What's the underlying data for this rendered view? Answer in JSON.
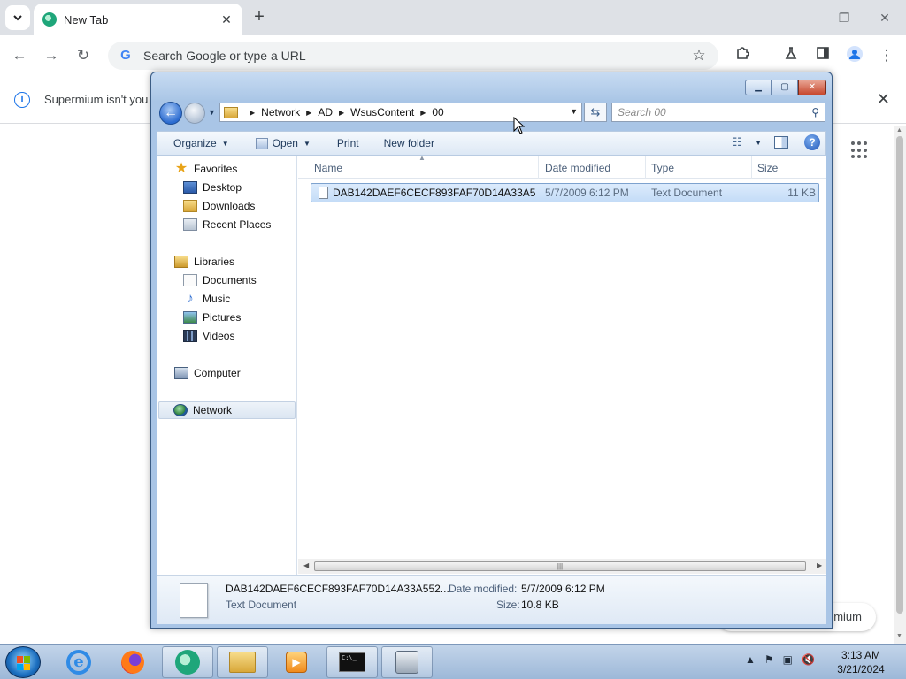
{
  "browser": {
    "tab_title": "New Tab",
    "tab_close_glyph": "✕",
    "new_tab_glyph": "+",
    "omnibox_placeholder": "Search Google or type a URL",
    "omnibox_g": "G",
    "infobar_message": "Supermium isn't you",
    "customize_chip_text": "mium",
    "icons": {
      "tab_search": "chevron-down-icon",
      "back": "back-arrow-icon",
      "forward": "forward-arrow-icon",
      "reload": "reload-icon",
      "bookmark": "star-icon",
      "extensions": "puzzle-icon",
      "labs": "flask-icon",
      "side_panel": "side-panel-icon",
      "profile": "profile-icon",
      "menu": "kebab-menu-icon"
    }
  },
  "explorer": {
    "breadcrumb": [
      "Network",
      "AD",
      "WsusContent",
      "00"
    ],
    "search_placeholder": "Search 00",
    "commands": {
      "organize": "Organize",
      "open": "Open",
      "print": "Print",
      "new_folder": "New folder"
    },
    "nav": {
      "favorites": "Favorites",
      "desktop": "Desktop",
      "downloads": "Downloads",
      "recent": "Recent Places",
      "libraries": "Libraries",
      "documents": "Documents",
      "music": "Music",
      "pictures": "Pictures",
      "videos": "Videos",
      "computer": "Computer",
      "network": "Network"
    },
    "columns": {
      "name": "Name",
      "date": "Date modified",
      "type": "Type",
      "size": "Size"
    },
    "files": [
      {
        "name": "DAB142DAEF6CECF893FAF70D14A33A55...",
        "date": "5/7/2009 6:12 PM",
        "type": "Text Document",
        "size": "11 KB"
      }
    ],
    "details": {
      "name": "DAB142DAEF6CECF893FAF70D14A33A552...",
      "type": "Text Document",
      "date_label": "Date modified:",
      "date_value": "5/7/2009 6:12 PM",
      "size_label": "Size:",
      "size_value": "10.8 KB"
    }
  },
  "taskbar": {
    "time": "3:13 AM",
    "date": "3/21/2024",
    "cmd_text": "C:\\_"
  },
  "colors": {
    "chrome_tabstrip": "#dee1e6",
    "selection": "#cce0f8",
    "accent_blue": "#1a73e8"
  }
}
